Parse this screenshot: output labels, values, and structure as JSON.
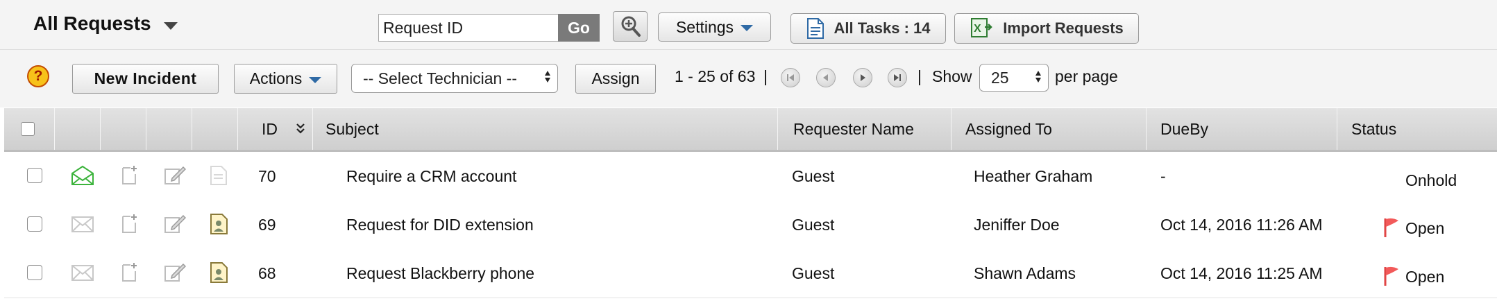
{
  "header": {
    "view_title": "All Requests",
    "search_value": "Request ID",
    "go_label": "Go",
    "settings_label": "Settings",
    "all_tasks_label": "All Tasks : 14",
    "import_label": "Import Requests"
  },
  "toolbar": {
    "help_glyph": "?",
    "new_incident_label": "New Incident",
    "actions_label": "Actions",
    "technician_select": "-- Select Technician --",
    "assign_label": "Assign",
    "range_text": "1 - 25 of 63",
    "separator": "|",
    "show_label": "Show",
    "per_page_value": "25",
    "per_page_label": "per page"
  },
  "table": {
    "columns": {
      "id": "ID",
      "subject": "Subject",
      "requester": "Requester Name",
      "assigned": "Assigned To",
      "dueby": "DueBy",
      "status": "Status"
    },
    "rows": [
      {
        "id": "70",
        "subject": "Require a CRM account",
        "requester": "Guest",
        "assigned": "Heather Graham",
        "dueby": "-",
        "status": "Onhold",
        "mail_icon": "open-mail-icon",
        "has_flag": false,
        "has_note": false
      },
      {
        "id": "69",
        "subject": "Request for DID extension",
        "requester": "Guest",
        "assigned": "Jeniffer Doe",
        "dueby": "Oct 14, 2016 11:26 AM",
        "status": "Open",
        "mail_icon": "mail-icon",
        "has_flag": true,
        "has_note": true
      },
      {
        "id": "68",
        "subject": "Request Blackberry phone",
        "requester": "Guest",
        "assigned": "Shawn Adams",
        "dueby": "Oct 14, 2016 11:25 AM",
        "status": "Open",
        "mail_icon": "mail-icon",
        "has_flag": true,
        "has_note": true
      }
    ]
  },
  "colors": {
    "flag_red": "#f25a5a",
    "open_mail_green": "#3cb33c",
    "dropdown_blue": "#2f6aa5"
  }
}
